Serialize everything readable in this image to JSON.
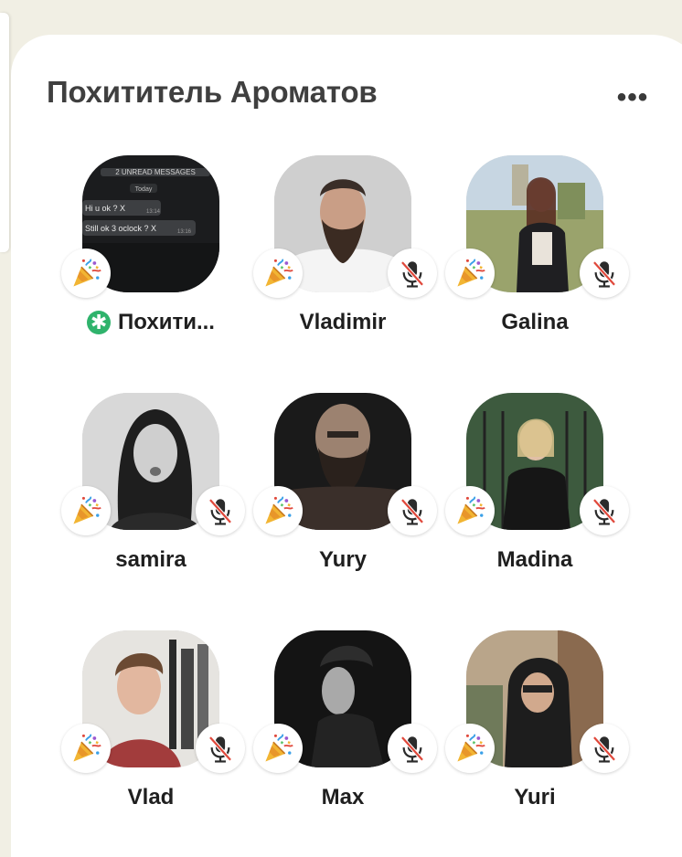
{
  "room": {
    "title": "Похититель Ароматов",
    "more_label": "•••"
  },
  "colors": {
    "background": "#f1efe4",
    "sheet": "#ffffff",
    "moderator_badge": "#2fb36c",
    "mute_slash": "#e0483b"
  },
  "icons": {
    "party": "party-popper-icon",
    "mute": "microphone-muted-icon",
    "moderator": "moderator-asterisk-icon"
  },
  "host_avatar_chat": {
    "unread_banner": "2 UNREAD MESSAGES",
    "day_label": "Today",
    "message_1": "Hi u ok ? X",
    "message_1_time": "13:14",
    "message_2": "Still ok 3 oclock ? X",
    "message_2_time": "13:16"
  },
  "speakers": [
    {
      "name": "Похити...",
      "moderator": true,
      "muted": false,
      "moderator_mark": "✱"
    },
    {
      "name": "Vladimir",
      "moderator": false,
      "muted": true
    },
    {
      "name": "Galina",
      "moderator": false,
      "muted": true
    },
    {
      "name": "samira",
      "moderator": false,
      "muted": true
    },
    {
      "name": "Yury",
      "moderator": false,
      "muted": true
    },
    {
      "name": "Madina",
      "moderator": false,
      "muted": true
    },
    {
      "name": "Vlad",
      "moderator": false,
      "muted": true
    },
    {
      "name": "Max",
      "moderator": false,
      "muted": true
    },
    {
      "name": "Yuri",
      "moderator": false,
      "muted": true
    }
  ]
}
